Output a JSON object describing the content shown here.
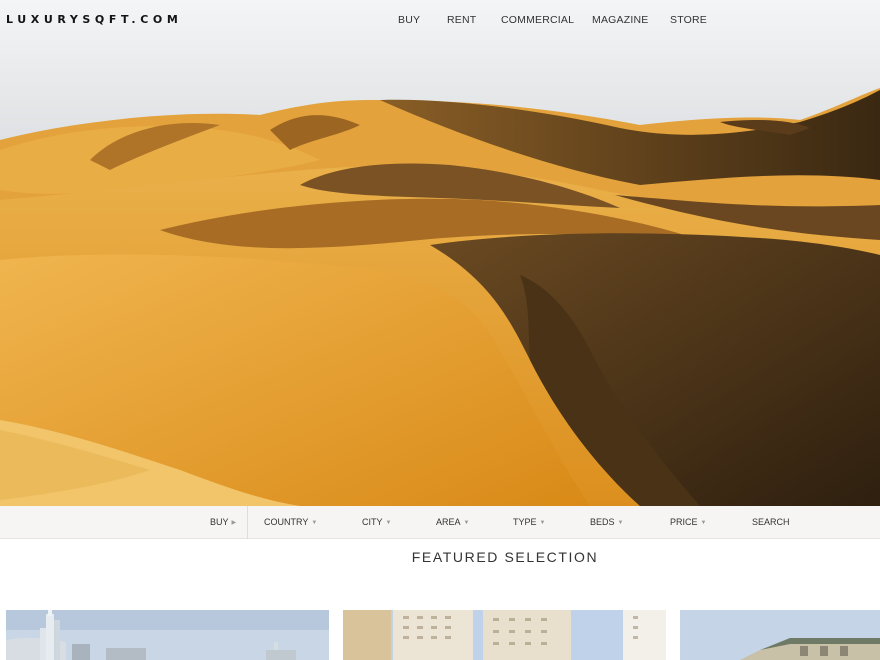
{
  "brand": {
    "logo": "LUXURYSQFT.COM"
  },
  "nav": {
    "items": [
      {
        "label": "BUY"
      },
      {
        "label": "RENT"
      },
      {
        "label": "COMMERCIAL"
      },
      {
        "label": "MAGAZINE"
      },
      {
        "label": "STORE"
      }
    ]
  },
  "hero": {
    "image": "desert-dunes-photo"
  },
  "search": {
    "filters": [
      {
        "label": "BUY",
        "icon": "caret-right-icon"
      },
      {
        "label": "COUNTRY",
        "icon": "caret-down-icon"
      },
      {
        "label": "CITY",
        "icon": "caret-down-icon"
      },
      {
        "label": "AREA",
        "icon": "caret-down-icon"
      },
      {
        "label": "TYPE",
        "icon": "caret-down-icon"
      },
      {
        "label": "BEDS",
        "icon": "caret-down-icon"
      },
      {
        "label": "PRICE",
        "icon": "caret-down-icon"
      }
    ],
    "submit_label": "SEARCH"
  },
  "featured": {
    "title": "FEATURED SELECTION",
    "cards": [
      {
        "image": "downtown-tower-photo"
      },
      {
        "image": "residential-towers-photo"
      },
      {
        "image": "villa-building-photo"
      }
    ]
  },
  "colors": {
    "sand_light": "#e9a93a",
    "sand_mid": "#d88d1c",
    "sand_shadow": "#3e2a14",
    "searchbar_bg": "#f6f5f3"
  }
}
